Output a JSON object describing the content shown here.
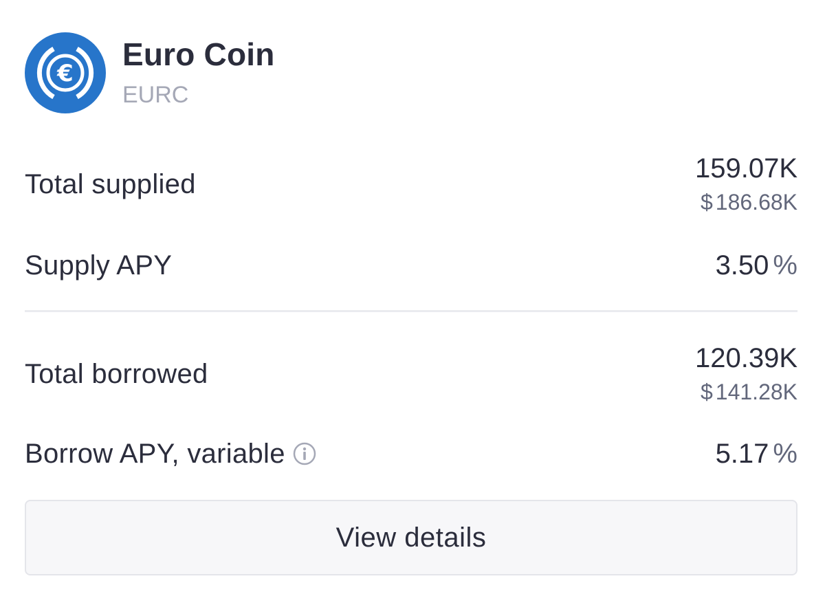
{
  "asset": {
    "name": "Euro Coin",
    "symbol": "EURC",
    "logo_icon": "euro-coin-icon",
    "brand_color": "#2775ca"
  },
  "supply": {
    "total_label": "Total supplied",
    "total_amount": "159.07K",
    "total_usd_currency": "$",
    "total_usd": "186.68K",
    "apy_label": "Supply APY",
    "apy_value": "3.50",
    "apy_unit": "%"
  },
  "borrow": {
    "total_label": "Total borrowed",
    "total_amount": "120.39K",
    "total_usd_currency": "$",
    "total_usd": "141.28K",
    "apy_label": "Borrow APY, variable",
    "apy_info_icon": "info-icon",
    "apy_value": "5.17",
    "apy_unit": "%"
  },
  "actions": {
    "view_details_label": "View details"
  }
}
